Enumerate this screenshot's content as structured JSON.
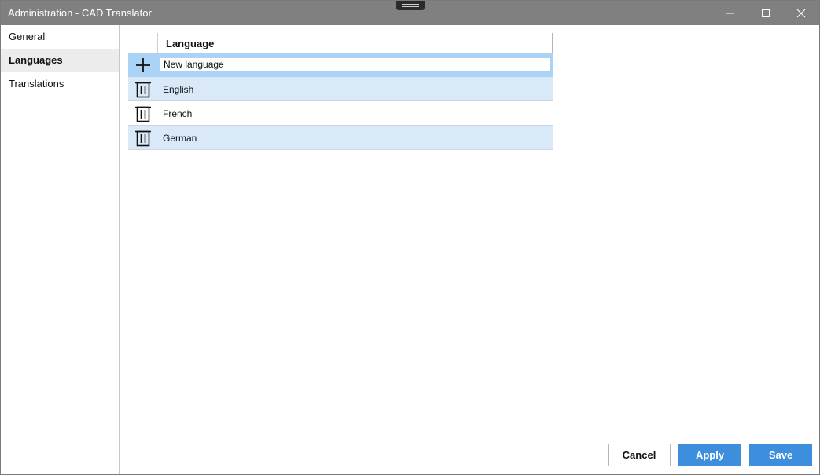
{
  "window": {
    "title": "Administration - CAD Translator",
    "titlebar_color": "#808080",
    "controls": {
      "minimize_icon": "minimize-icon",
      "maximize_icon": "maximize-icon",
      "close_icon": "close-icon"
    }
  },
  "sidebar": {
    "items": [
      {
        "label": "General",
        "active": false
      },
      {
        "label": "Languages",
        "active": true
      },
      {
        "label": "Translations",
        "active": false
      }
    ]
  },
  "grid": {
    "column_header": "Language",
    "new_row": {
      "icon": "plus-icon",
      "value": "New language"
    },
    "rows": [
      {
        "label": "English",
        "icon": "trash-icon"
      },
      {
        "label": "French",
        "icon": "trash-icon"
      },
      {
        "label": "German",
        "icon": "trash-icon"
      }
    ],
    "new_row_color": "#aad3f5",
    "alt_row_color": "#d9e9f8"
  },
  "footer": {
    "cancel_label": "Cancel",
    "apply_label": "Apply",
    "save_label": "Save",
    "accent_color": "#3d8fde"
  }
}
